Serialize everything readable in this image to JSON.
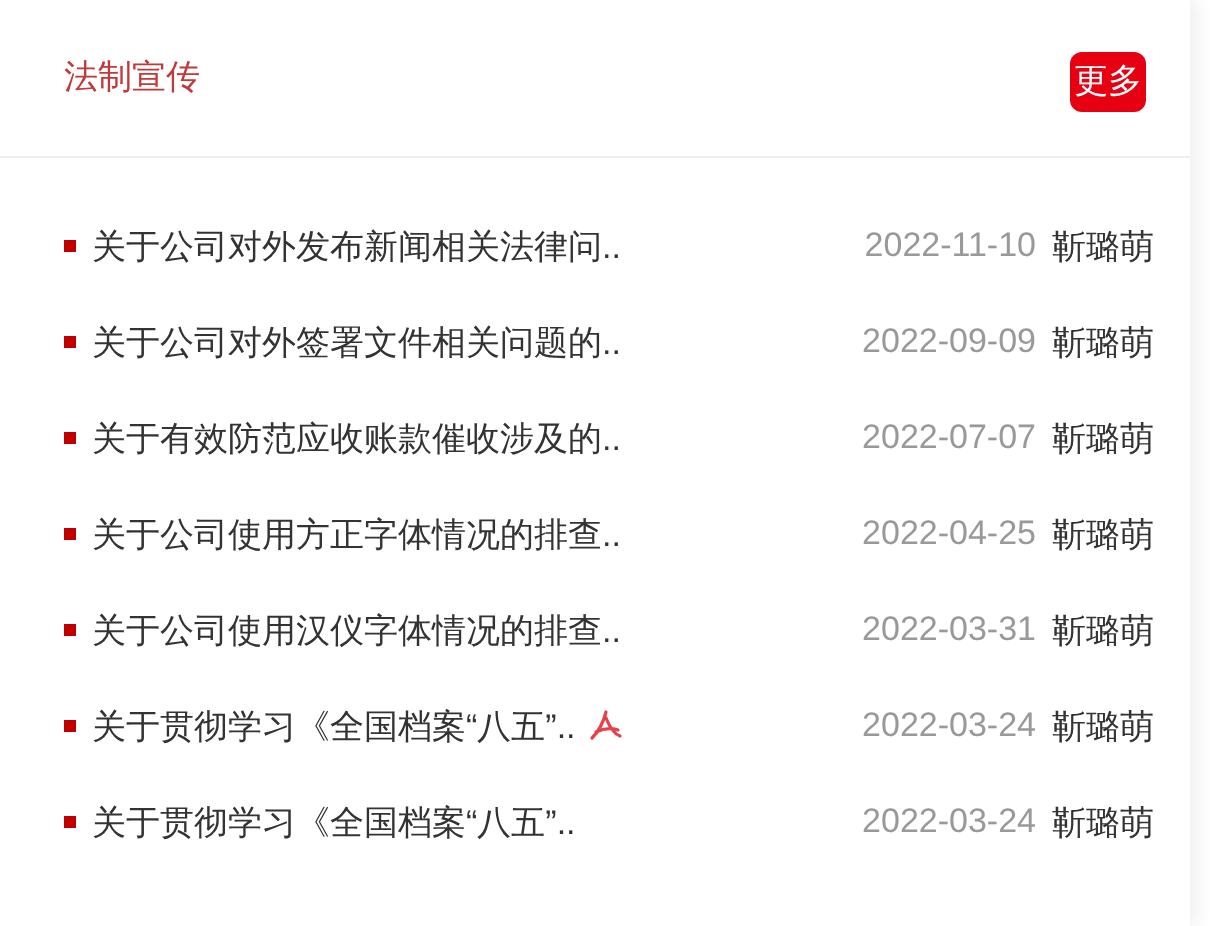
{
  "header": {
    "title": "法制宣传",
    "more": "更多"
  },
  "items": [
    {
      "title": "关于公司对外发布新闻相关法律问..",
      "date": "2022-11-10",
      "author": "靳璐萌",
      "attachment": false
    },
    {
      "title": "关于公司对外签署文件相关问题的..",
      "date": "2022-09-09",
      "author": "靳璐萌",
      "attachment": false
    },
    {
      "title": "关于有效防范应收账款催收涉及的..",
      "date": "2022-07-07",
      "author": "靳璐萌",
      "attachment": false
    },
    {
      "title": "关于公司使用方正字体情况的排查..",
      "date": "2022-04-25",
      "author": "靳璐萌",
      "attachment": false
    },
    {
      "title": "关于公司使用汉仪字体情况的排查..",
      "date": "2022-03-31",
      "author": "靳璐萌",
      "attachment": false
    },
    {
      "title": "关于贯彻学习《全国档案“八五”..",
      "date": "2022-03-24",
      "author": "靳璐萌",
      "attachment": true
    },
    {
      "title": "关于贯彻学习《全国档案“八五”..",
      "date": "2022-03-24",
      "author": "靳璐萌",
      "attachment": false
    }
  ]
}
